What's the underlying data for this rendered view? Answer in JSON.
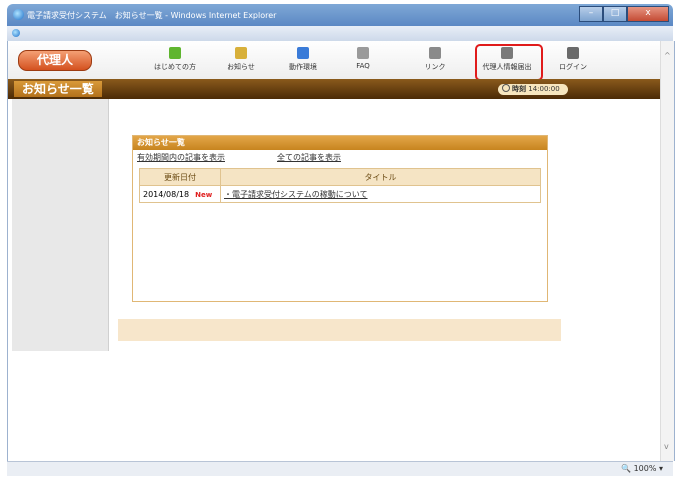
{
  "window": {
    "title": "電子請求受付システム　お知らせ一覧 - Windows Internet Explorer"
  },
  "header": {
    "agent_button": "代理人",
    "nav": [
      {
        "label": "はじめての方",
        "icon": "beginner-leaf-icon",
        "color": "#5fb52f"
      },
      {
        "label": "お知らせ",
        "icon": "info-icon",
        "color": "#d8b03a"
      },
      {
        "label": "動作環境",
        "icon": "monitor-icon",
        "color": "#3a7bd8"
      },
      {
        "label": "FAQ",
        "icon": "faq-icon",
        "color": "#9a9a9a"
      },
      {
        "label": "リンク",
        "icon": "link-icon",
        "color": "#8a8a8a"
      },
      {
        "label": "代理人情報届出",
        "icon": "agent-info-icon",
        "color": "#7a7a7a"
      },
      {
        "label": "ログイン",
        "icon": "login-icon",
        "color": "#6a6a6a"
      }
    ]
  },
  "band": {
    "page_title": "お知らせ一覧",
    "clock_label": "時刻",
    "clock_time": "14:00:00"
  },
  "news": {
    "heading": "お知らせ一覧",
    "link_valid": "有効期間内の記事を表示",
    "link_all": "全ての記事を表示",
    "columns": [
      "更新日付",
      "タイトル"
    ],
    "rows": [
      {
        "date": "2014/08/18",
        "badge": "New",
        "title": "・電子請求受付システムの稼動について"
      }
    ]
  },
  "status": {
    "zoom": "100%"
  },
  "colors": {
    "accent": "#c7841e",
    "highlight": "#e01b1b"
  }
}
